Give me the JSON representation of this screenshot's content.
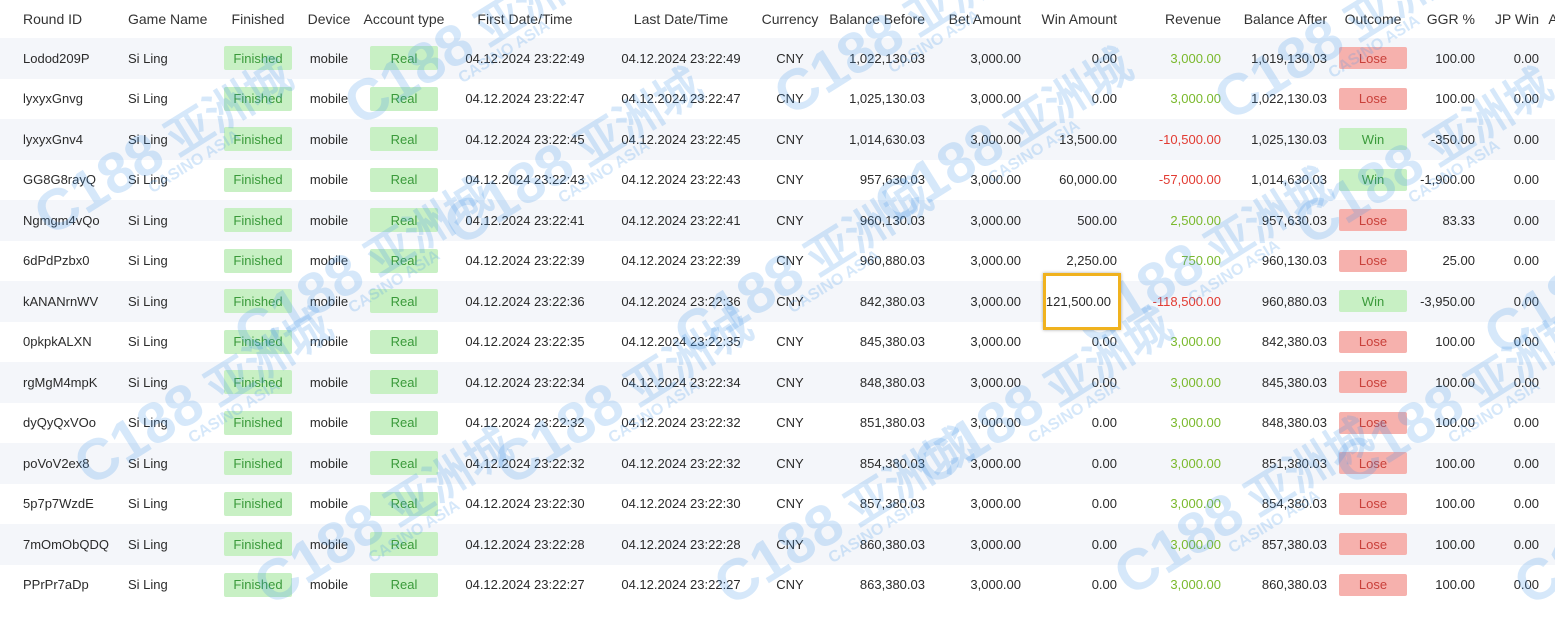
{
  "table": {
    "headers": [
      "Round ID",
      "Game Name",
      "Outcome",
      "Device",
      "Account type",
      "First Date/Time",
      "Last Date/Time",
      "Currency",
      "Balance Before",
      "Bet Amount",
      "Win Amount",
      "Revenue",
      "Balance After",
      "Outcome",
      "GGR %",
      "JP Win",
      "A"
    ],
    "status_header": "Finished",
    "rows": [
      {
        "round_id": "Lodod209P",
        "game": "Si Ling",
        "status": "Finished",
        "device": "mobile",
        "account": "Real",
        "first": "04.12.2024 23:22:49",
        "last": "04.12.2024 23:22:49",
        "currency": "CNY",
        "bal_before": "1,022,130.03",
        "bet": "3,000.00",
        "win": "0.00",
        "revenue": "3,000.00",
        "rev_sign": "pos",
        "bal_after": "1,019,130.03",
        "outcome": "Lose",
        "ggr": "100.00",
        "jp": "0.00"
      },
      {
        "round_id": "lyxyxGnvg",
        "game": "Si Ling",
        "status": "Finished",
        "device": "mobile",
        "account": "Real",
        "first": "04.12.2024 23:22:47",
        "last": "04.12.2024 23:22:47",
        "currency": "CNY",
        "bal_before": "1,025,130.03",
        "bet": "3,000.00",
        "win": "0.00",
        "revenue": "3,000.00",
        "rev_sign": "pos",
        "bal_after": "1,022,130.03",
        "outcome": "Lose",
        "ggr": "100.00",
        "jp": "0.00"
      },
      {
        "round_id": "lyxyxGnv4",
        "game": "Si Ling",
        "status": "Finished",
        "device": "mobile",
        "account": "Real",
        "first": "04.12.2024 23:22:45",
        "last": "04.12.2024 23:22:45",
        "currency": "CNY",
        "bal_before": "1,014,630.03",
        "bet": "3,000.00",
        "win": "13,500.00",
        "revenue": "-10,500.00",
        "rev_sign": "neg",
        "bal_after": "1,025,130.03",
        "outcome": "Win",
        "ggr": "-350.00",
        "jp": "0.00"
      },
      {
        "round_id": "GG8G8rayQ",
        "game": "Si Ling",
        "status": "Finished",
        "device": "mobile",
        "account": "Real",
        "first": "04.12.2024 23:22:43",
        "last": "04.12.2024 23:22:43",
        "currency": "CNY",
        "bal_before": "957,630.03",
        "bet": "3,000.00",
        "win": "60,000.00",
        "revenue": "-57,000.00",
        "rev_sign": "neg",
        "bal_after": "1,014,630.03",
        "outcome": "Win",
        "ggr": "-1,900.00",
        "jp": "0.00"
      },
      {
        "round_id": "Ngmgm4vQo",
        "game": "Si Ling",
        "status": "Finished",
        "device": "mobile",
        "account": "Real",
        "first": "04.12.2024 23:22:41",
        "last": "04.12.2024 23:22:41",
        "currency": "CNY",
        "bal_before": "960,130.03",
        "bet": "3,000.00",
        "win": "500.00",
        "revenue": "2,500.00",
        "rev_sign": "pos",
        "bal_after": "957,630.03",
        "outcome": "Lose",
        "ggr": "83.33",
        "jp": "0.00"
      },
      {
        "round_id": "6dPdPzbx0",
        "game": "Si Ling",
        "status": "Finished",
        "device": "mobile",
        "account": "Real",
        "first": "04.12.2024 23:22:39",
        "last": "04.12.2024 23:22:39",
        "currency": "CNY",
        "bal_before": "960,880.03",
        "bet": "3,000.00",
        "win": "2,250.00",
        "revenue": "750.00",
        "rev_sign": "pos",
        "bal_after": "960,130.03",
        "outcome": "Lose",
        "ggr": "25.00",
        "jp": "0.00"
      },
      {
        "round_id": "kANANrnWV",
        "game": "Si Ling",
        "status": "Finished",
        "device": "mobile",
        "account": "Real",
        "first": "04.12.2024 23:22:36",
        "last": "04.12.2024 23:22:36",
        "currency": "CNY",
        "bal_before": "842,380.03",
        "bet": "3,000.00",
        "win": "121,500.00",
        "revenue": "-118,500.00",
        "rev_sign": "neg",
        "bal_after": "960,880.03",
        "outcome": "Win",
        "ggr": "-3,950.00",
        "jp": "0.00",
        "highlight": true
      },
      {
        "round_id": "0pkpkALXN",
        "game": "Si Ling",
        "status": "Finished",
        "device": "mobile",
        "account": "Real",
        "first": "04.12.2024 23:22:35",
        "last": "04.12.2024 23:22:35",
        "currency": "CNY",
        "bal_before": "845,380.03",
        "bet": "3,000.00",
        "win": "0.00",
        "revenue": "3,000.00",
        "rev_sign": "pos",
        "bal_after": "842,380.03",
        "outcome": "Lose",
        "ggr": "100.00",
        "jp": "0.00"
      },
      {
        "round_id": "rgMgM4mpK",
        "game": "Si Ling",
        "status": "Finished",
        "device": "mobile",
        "account": "Real",
        "first": "04.12.2024 23:22:34",
        "last": "04.12.2024 23:22:34",
        "currency": "CNY",
        "bal_before": "848,380.03",
        "bet": "3,000.00",
        "win": "0.00",
        "revenue": "3,000.00",
        "rev_sign": "pos",
        "bal_after": "845,380.03",
        "outcome": "Lose",
        "ggr": "100.00",
        "jp": "0.00"
      },
      {
        "round_id": "dyQyQxVOo",
        "game": "Si Ling",
        "status": "Finished",
        "device": "mobile",
        "account": "Real",
        "first": "04.12.2024 23:22:32",
        "last": "04.12.2024 23:22:32",
        "currency": "CNY",
        "bal_before": "851,380.03",
        "bet": "3,000.00",
        "win": "0.00",
        "revenue": "3,000.00",
        "rev_sign": "pos",
        "bal_after": "848,380.03",
        "outcome": "Lose",
        "ggr": "100.00",
        "jp": "0.00"
      },
      {
        "round_id": "poVoV2ex8",
        "game": "Si Ling",
        "status": "Finished",
        "device": "mobile",
        "account": "Real",
        "first": "04.12.2024 23:22:32",
        "last": "04.12.2024 23:22:32",
        "currency": "CNY",
        "bal_before": "854,380.03",
        "bet": "3,000.00",
        "win": "0.00",
        "revenue": "3,000.00",
        "rev_sign": "pos",
        "bal_after": "851,380.03",
        "outcome": "Lose",
        "ggr": "100.00",
        "jp": "0.00"
      },
      {
        "round_id": "5p7p7WzdE",
        "game": "Si Ling",
        "status": "Finished",
        "device": "mobile",
        "account": "Real",
        "first": "04.12.2024 23:22:30",
        "last": "04.12.2024 23:22:30",
        "currency": "CNY",
        "bal_before": "857,380.03",
        "bet": "3,000.00",
        "win": "0.00",
        "revenue": "3,000.00",
        "rev_sign": "pos",
        "bal_after": "854,380.03",
        "outcome": "Lose",
        "ggr": "100.00",
        "jp": "0.00"
      },
      {
        "round_id": "7mOmObQDQ",
        "game": "Si Ling",
        "status": "Finished",
        "device": "mobile",
        "account": "Real",
        "first": "04.12.2024 23:22:28",
        "last": "04.12.2024 23:22:28",
        "currency": "CNY",
        "bal_before": "860,380.03",
        "bet": "3,000.00",
        "win": "0.00",
        "revenue": "3,000.00",
        "rev_sign": "pos",
        "bal_after": "857,380.03",
        "outcome": "Lose",
        "ggr": "100.00",
        "jp": "0.00"
      },
      {
        "round_id": "PPrPr7aDp",
        "game": "Si Ling",
        "status": "Finished",
        "device": "mobile",
        "account": "Real",
        "first": "04.12.2024 23:22:27",
        "last": "04.12.2024 23:22:27",
        "currency": "CNY",
        "bal_before": "863,380.03",
        "bet": "3,000.00",
        "win": "0.00",
        "revenue": "3,000.00",
        "rev_sign": "pos",
        "bal_after": "860,380.03",
        "outcome": "Lose",
        "ggr": "100.00",
        "jp": "0.00"
      }
    ]
  },
  "watermark": {
    "logo": "C188",
    "cn": "亚洲城",
    "sub": "CASINO ASIA"
  },
  "colors": {
    "positive": "#7ab92c",
    "negative": "#e23b32",
    "badge_green_bg": "#c8f0c4",
    "badge_red_bg": "#f6b1ad",
    "highlight": "#f0b21e"
  }
}
